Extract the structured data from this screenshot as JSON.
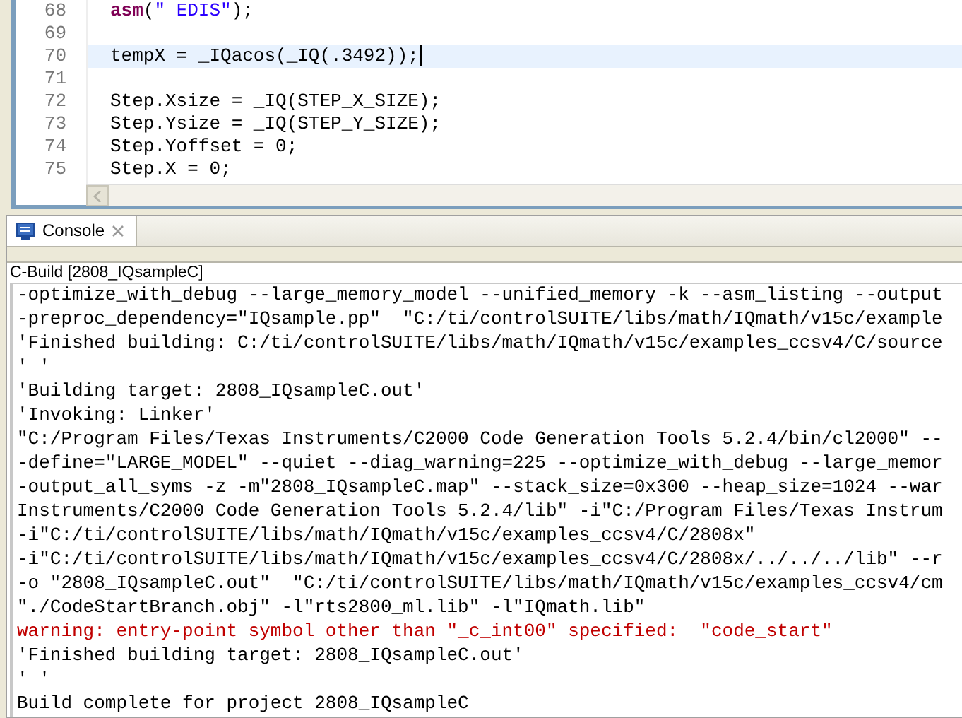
{
  "editor": {
    "lines": [
      {
        "number": "68",
        "current": false,
        "segments": [
          {
            "kind": "keyword",
            "text": "asm"
          },
          {
            "kind": "plain",
            "text": "("
          },
          {
            "kind": "string",
            "text": "\" EDIS\""
          },
          {
            "kind": "plain",
            "text": ");"
          }
        ]
      },
      {
        "number": "69",
        "current": false
      },
      {
        "number": "70",
        "current": true,
        "segments": [
          {
            "kind": "plain",
            "text": "tempX = _IQacos(_IQ(.3492));"
          }
        ]
      },
      {
        "number": "71",
        "current": false
      },
      {
        "number": "72",
        "current": false,
        "segments": [
          {
            "kind": "plain",
            "text": "Step.Xsize = _IQ(STEP_X_SIZE);"
          }
        ]
      },
      {
        "number": "73",
        "current": false,
        "segments": [
          {
            "kind": "plain",
            "text": "Step.Ysize = _IQ(STEP_Y_SIZE);"
          }
        ]
      },
      {
        "number": "74",
        "current": false,
        "segments": [
          {
            "kind": "plain",
            "text": "Step.Yoffset = 0;"
          }
        ]
      },
      {
        "number": "75",
        "current": false,
        "segments": [
          {
            "kind": "plain",
            "text": "Step.X = 0;"
          }
        ]
      }
    ]
  },
  "console": {
    "tab": {
      "label": "Console",
      "selected": true
    },
    "header": "C-Build [2808_IQsampleC]",
    "lines": [
      {
        "kind": "info",
        "text": "-optimize_with_debug --large_memory_model --unified_memory -k --asm_listing --output"
      },
      {
        "kind": "info",
        "text": "-preproc_dependency=\"IQsample.pp\"  \"C:/ti/controlSUITE/libs/math/IQmath/v15c/example"
      },
      {
        "kind": "info",
        "text": "'Finished building: C:/ti/controlSUITE/libs/math/IQmath/v15c/examples_ccsv4/C/source"
      },
      {
        "kind": "info",
        "text": "' '"
      },
      {
        "kind": "info",
        "text": "'Building target: 2808_IQsampleC.out'"
      },
      {
        "kind": "info",
        "text": "'Invoking: Linker'"
      },
      {
        "kind": "info",
        "text": "\"C:/Program Files/Texas Instruments/C2000 Code Generation Tools 5.2.4/bin/cl2000\" --"
      },
      {
        "kind": "info",
        "text": "-define=\"LARGE_MODEL\" --quiet --diag_warning=225 --optimize_with_debug --large_memor"
      },
      {
        "kind": "info",
        "text": "-output_all_syms -z -m\"2808_IQsampleC.map\" --stack_size=0x300 --heap_size=1024 --war"
      },
      {
        "kind": "info",
        "text": "Instruments/C2000 Code Generation Tools 5.2.4/lib\" -i\"C:/Program Files/Texas Instrum"
      },
      {
        "kind": "info",
        "text": "-i\"C:/ti/controlSUITE/libs/math/IQmath/v15c/examples_ccsv4/C/2808x\""
      },
      {
        "kind": "info",
        "text": "-i\"C:/ti/controlSUITE/libs/math/IQmath/v15c/examples_ccsv4/C/2808x/../../../lib\" --r"
      },
      {
        "kind": "info",
        "text": "-o \"2808_IQsampleC.out\"  \"C:/ti/controlSUITE/libs/math/IQmath/v15c/examples_ccsv4/cm"
      },
      {
        "kind": "info",
        "text": "\"./CodeStartBranch.obj\" -l\"rts2800_ml.lib\" -l\"IQmath.lib\""
      },
      {
        "kind": "warning",
        "text": "warning: entry-point symbol other than \"_c_int00\" specified:  \"code_start\""
      },
      {
        "kind": "info",
        "text": "'Finished building target: 2808_IQsampleC.out'"
      },
      {
        "kind": "info",
        "text": "' '"
      },
      {
        "kind": "info",
        "text": "Build complete for project 2808_IQsampleC"
      }
    ]
  }
}
